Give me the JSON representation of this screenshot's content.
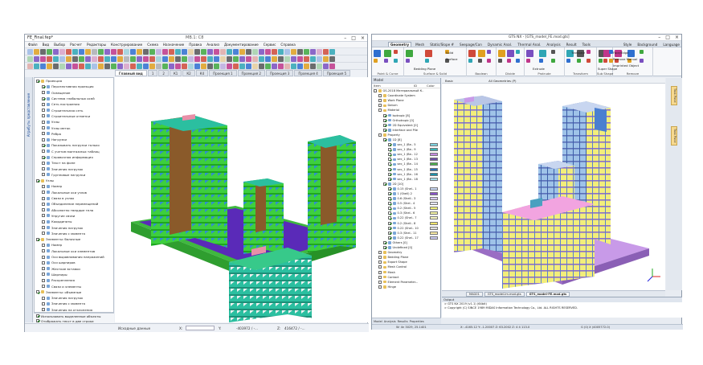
{
  "left_app": {
    "title": "FE_Final.fep*",
    "doc_title": "MB.1: C8",
    "menu": [
      "Файл",
      "Вид",
      "Выбор",
      "Расчет",
      "Редакторы",
      "Конструирование",
      "Схема",
      "Назначение",
      "Правка",
      "Анализ",
      "Документирование",
      "Сервис",
      "Справка"
    ],
    "tabs": [
      "Главный вид",
      "1",
      "2",
      "К1",
      "К2",
      "К4",
      "Проекция 1",
      "Проекция 2",
      "Проекция 3",
      "Проекция 4",
      "Проекция 5"
    ],
    "side_strip": "Атрибуты представления",
    "tree": [
      {
        "label": "Проекция",
        "indent": 0,
        "checked": true,
        "icon": "folder"
      },
      {
        "label": "Перспективная проекция",
        "indent": 1,
        "checked": true
      },
      {
        "label": "Освещение",
        "indent": 1,
        "checked": false
      },
      {
        "label": "Система глобальных осей",
        "indent": 1,
        "checked": true
      },
      {
        "label": "Сеть построения",
        "indent": 1,
        "checked": false
      },
      {
        "label": "Строительная сеть",
        "indent": 1,
        "checked": false
      },
      {
        "label": "Строительные отметки",
        "indent": 1,
        "checked": false
      },
      {
        "label": "Узлы",
        "indent": 1,
        "checked": false
      },
      {
        "label": "Узлы меток",
        "indent": 1,
        "checked": false
      },
      {
        "label": "Ребра",
        "indent": 1,
        "checked": false
      },
      {
        "label": "Нагрузки",
        "indent": 1,
        "checked": false
      },
      {
        "label": "Показывать нагрузки только",
        "indent": 1,
        "checked": true
      },
      {
        "label": "С учетом монтажных таблиц",
        "indent": 1,
        "checked": false
      },
      {
        "label": "Справочная информация",
        "indent": 1,
        "checked": true
      },
      {
        "label": "Текст на фоне",
        "indent": 1,
        "checked": false
      },
      {
        "label": "Значения нагрузок",
        "indent": 1,
        "checked": false
      },
      {
        "label": "Групповые нагрузки",
        "indent": 1,
        "checked": false
      },
      {
        "label": "Узлы",
        "indent": 0,
        "checked": true,
        "icon": "folder"
      },
      {
        "label": "Номер",
        "indent": 1,
        "checked": false
      },
      {
        "label": "Локальные оси узлов",
        "indent": 1,
        "checked": false
      },
      {
        "label": "Связи в узлах",
        "indent": 1,
        "checked": false
      },
      {
        "label": "Объединение перемещений",
        "indent": 1,
        "checked": false
      },
      {
        "label": "Абсолютно твердые тела",
        "indent": 1,
        "checked": false
      },
      {
        "label": "Упругие связи",
        "indent": 1,
        "checked": false
      },
      {
        "label": "Координаты",
        "indent": 1,
        "checked": false
      },
      {
        "label": "Значения нагрузок",
        "indent": 1,
        "checked": false
      },
      {
        "label": "Значения с момента",
        "indent": 1,
        "checked": false
      },
      {
        "label": "Элементы: балочные",
        "indent": 0,
        "checked": true,
        "icon": "folder"
      },
      {
        "label": "Номер",
        "indent": 1,
        "checked": false
      },
      {
        "label": "Локальные оси элементов",
        "indent": 1,
        "checked": false
      },
      {
        "label": "Оси выравнивания напряжений",
        "indent": 1,
        "checked": false
      },
      {
        "label": "Оси шарниров",
        "indent": 1,
        "checked": false
      },
      {
        "label": "Жесткие вставки",
        "indent": 1,
        "checked": false
      },
      {
        "label": "Шарниры",
        "indent": 1,
        "checked": false
      },
      {
        "label": "Раскрепления",
        "indent": 1,
        "checked": false
      },
      {
        "label": "Связи и элементы",
        "indent": 1,
        "checked": false
      },
      {
        "label": "Элементы: объемные",
        "indent": 0,
        "checked": true,
        "icon": "folder"
      },
      {
        "label": "Значения нагрузок",
        "indent": 1,
        "checked": false
      },
      {
        "label": "Значения с момента",
        "indent": 1,
        "checked": false
      },
      {
        "label": "Значения на отклонения",
        "indent": 1,
        "checked": false
      }
    ],
    "options": [
      "Использовать выделенные объекты",
      "Отображать текст в две строки",
      "Добавлять префиксы к значениям"
    ],
    "apply_label": "Применить",
    "status": {
      "mode": "Исходные данные",
      "x_label": "X:",
      "y_label": "Y:",
      "z_label": "Z:",
      "x_value": "",
      "y_value": "-403972 / -...",
      "z_value": "416472 / -..."
    }
  },
  "right_app": {
    "title": "GTS NX - [GTS_model_FE.mod.gts]",
    "ribbon_tabs": [
      "Geometry",
      "Mesh",
      "Static/Slope #",
      "Seepage/Con",
      "Dynamic Anal.",
      "Thermal Anal.",
      "Analysis",
      "Result",
      "Tools"
    ],
    "ribbon_right": [
      "Style",
      "Background",
      "Language"
    ],
    "groups": [
      {
        "label": "Point & Curve"
      },
      {
        "label": "Surface & Solid"
      },
      {
        "label": "Boolean"
      },
      {
        "label": "Divide"
      },
      {
        "label": "Protrude"
      },
      {
        "label": "Transform"
      },
      {
        "label": "Sub Shape"
      },
      {
        "label": "Remove"
      }
    ],
    "ribbon_items": [
      "Bedding Plane",
      "Solid",
      "Surface",
      "Extrude",
      "Translate",
      "Face/Edge",
      "Remove Manual",
      "Imprinted Object",
      "Super Shape"
    ],
    "tree_header": "Model",
    "tree_cols": [
      "Item",
      "ID",
      "Color"
    ],
    "tree": [
      {
        "label": "GS-2018 Материальный К..",
        "indent": 0,
        "color": ""
      },
      {
        "label": "Coordinate System",
        "indent": 1,
        "color": ""
      },
      {
        "label": "Work Plane",
        "indent": 1,
        "color": ""
      },
      {
        "label": "Datum",
        "indent": 1,
        "color": ""
      },
      {
        "label": "Material",
        "indent": 1,
        "color": ""
      },
      {
        "label": "Isotropic [8]",
        "indent": 2,
        "color": ""
      },
      {
        "label": "Orthotropic [0]",
        "indent": 2,
        "color": ""
      },
      {
        "label": "2D Equivalent [0]",
        "indent": 2,
        "color": ""
      },
      {
        "label": "Interface and Pile",
        "indent": 2,
        "color": ""
      },
      {
        "label": "Property",
        "indent": 1,
        "color": ""
      },
      {
        "label": "1D [8]",
        "indent": 2,
        "color": ""
      },
      {
        "label": "sec_1 (Be.. 5",
        "indent": 3,
        "color": "#7fd3e0"
      },
      {
        "label": "sec_1 (Be.. 9",
        "indent": 3,
        "color": "#3bb3b3"
      },
      {
        "label": "sec_1 (Be.. 12",
        "indent": 3,
        "color": "#c58ae0"
      },
      {
        "label": "sec_1 (Be.. 13",
        "indent": 3,
        "color": "#6e4ea8"
      },
      {
        "label": "sec_1 (Be.. 14",
        "indent": 3,
        "color": "#4bb04b"
      },
      {
        "label": "sec_1 (Be.. 15",
        "indent": 3,
        "color": "#2a6fb5"
      },
      {
        "label": "sec_1 (Be.. 16",
        "indent": 3,
        "color": "#1c8fa8"
      },
      {
        "label": "sec_1 (Be.. 18",
        "indent": 3,
        "color": "#9edbe8"
      },
      {
        "label": "2D [10]",
        "indent": 2,
        "color": ""
      },
      {
        "label": "0.15 (Shel.. 1",
        "indent": 3,
        "color": "#c7d6f2"
      },
      {
        "label": "1 (Shell) 2",
        "indent": 3,
        "color": "#8a52c9"
      },
      {
        "label": "0.6 (Shell.. 3",
        "indent": 3,
        "color": "#d9c9f0"
      },
      {
        "label": "0.5 (Shel.. 4",
        "indent": 3,
        "color": "#e6e6f7"
      },
      {
        "label": "0.2 (Shell.. 5",
        "indent": 3,
        "color": "#f2f27a"
      },
      {
        "label": "0.3 (Shel.. 6",
        "indent": 3,
        "color": "#f2f2a0"
      },
      {
        "label": "0.22 (Shel.. 7",
        "indent": 3,
        "color": "#f5f5c0"
      },
      {
        "label": "0.2 (Shell.. 8",
        "indent": 3,
        "color": "#f0e46a"
      },
      {
        "label": "0.22 (Shel.. 10",
        "indent": 3,
        "color": "#e0e0e0"
      },
      {
        "label": "0.3 (Shel.. 11",
        "indent": 3,
        "color": "#f7e9a0"
      },
      {
        "label": "0.22 (Shel.. 17",
        "indent": 3,
        "color": "#c8c8f0"
      },
      {
        "label": "Others [0]",
        "indent": 2,
        "color": ""
      },
      {
        "label": "Undefined [0]",
        "indent": 2,
        "color": ""
      },
      {
        "label": "Geometry",
        "indent": 1,
        "color": ""
      },
      {
        "label": "Bedding Plane",
        "indent": 1,
        "color": ""
      },
      {
        "label": "Export Shape",
        "indent": 1,
        "color": ""
      },
      {
        "label": "Mesh Control",
        "indent": 1,
        "color": ""
      },
      {
        "label": "Mesh",
        "indent": 1,
        "color": ""
      },
      {
        "label": "Contact",
        "indent": 1,
        "color": ""
      },
      {
        "label": "Element Parameter...",
        "indent": 1,
        "color": ""
      },
      {
        "label": "Hinge",
        "indent": 1,
        "color": ""
      }
    ],
    "model_tabs": [
      "Model",
      "Analysis",
      "Results",
      "Properties"
    ],
    "view_toolbar": [
      "Basic",
      "All Geometries (P)"
    ],
    "doc_tabs": [
      "MAG01",
      "GTS_model-Im.mod.gts",
      "GTS_model-FE.mod.gts"
    ],
    "side_tabs": [
      "Task Pane",
      "Task Pane"
    ],
    "output_header": "Output",
    "output_lines": [
      "> GTS NX 2019 (v1.1) (64bit)",
      "> Copyright (C) SINCE 1989 MIDAS Information Technology Co., Ltd. ALL RIGHTS RESERVED."
    ],
    "status_left": "W: 4n 3029, 25.1401",
    "status_mid": "X: -4165.12 Y: -1.20007 Z: 63.2002 Z: 4 4 113.0",
    "status_right": "G (0) X (4005772.0)"
  }
}
